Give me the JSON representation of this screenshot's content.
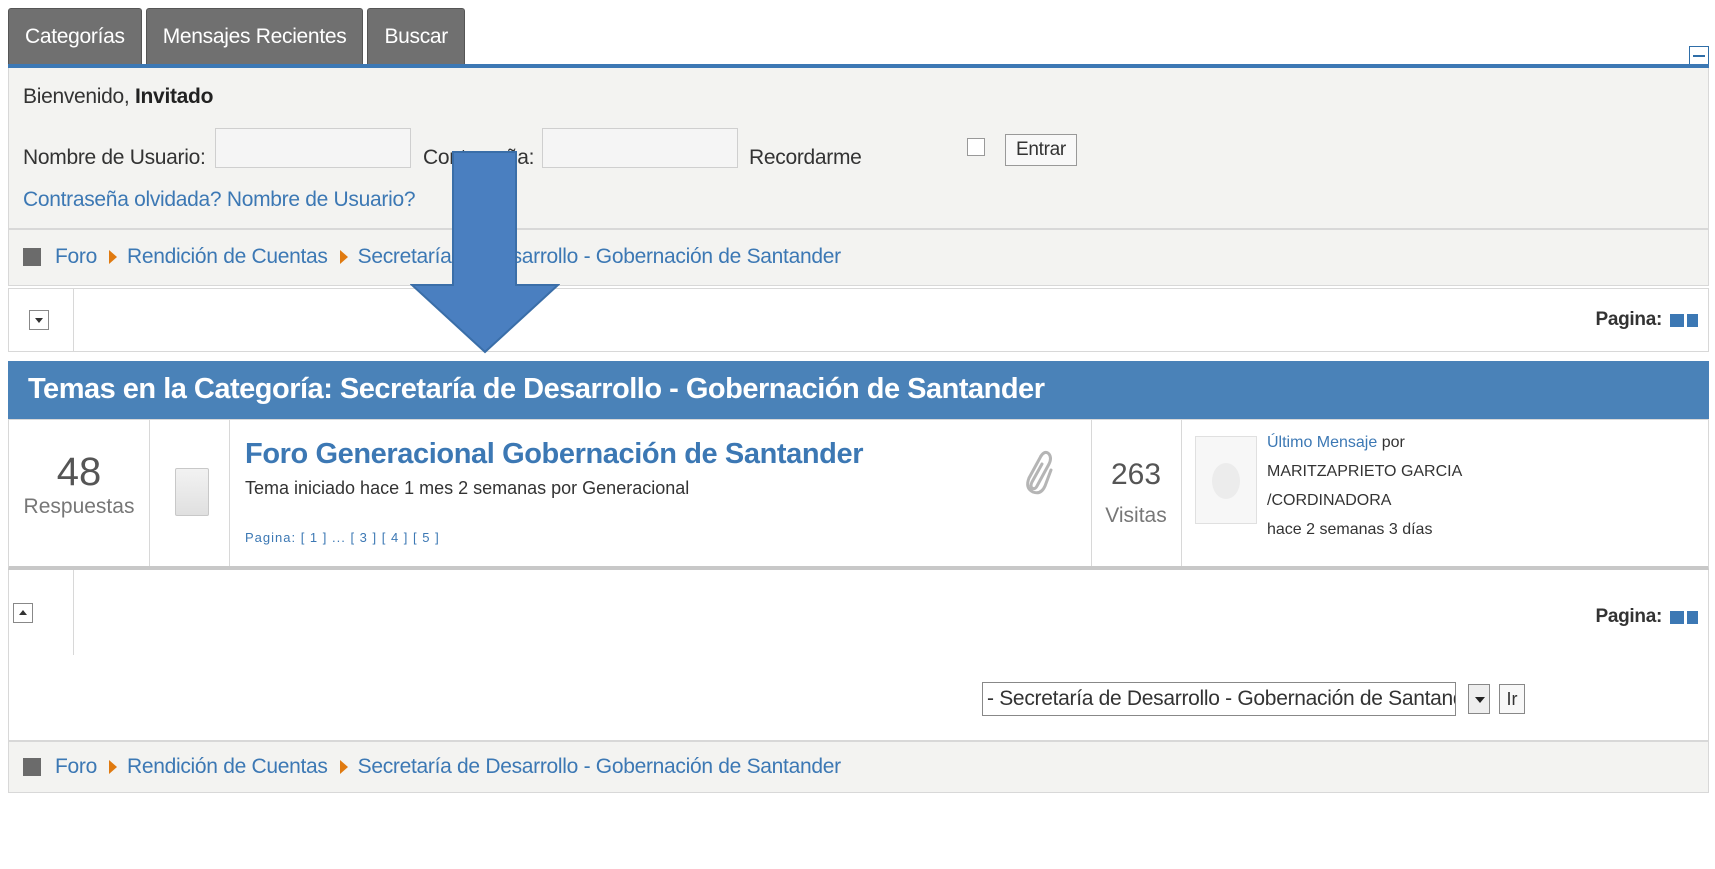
{
  "tabs": [
    "Categorías",
    "Mensajes Recientes",
    "Buscar"
  ],
  "login": {
    "welcome_prefix": "Bienvenido,",
    "welcome_user": "Invitado",
    "username_label": "Nombre de Usuario:",
    "password_label": "Contraseña:",
    "remember_label": "Recordarme",
    "submit_label": "Entrar",
    "forgot_link": "Contraseña olvidada? Nombre de Usuario?"
  },
  "breadcrumb": {
    "items": [
      "Foro",
      "Rendición de Cuentas",
      "Secretaría de Desarrollo - Gobernación de Santander"
    ]
  },
  "pager": {
    "label": "Pagina:"
  },
  "category": {
    "header": "Temas en la Categoría: Secretaría de Desarrollo - Gobernación de Santander"
  },
  "topic": {
    "replies": "48",
    "replies_label": "Respuestas",
    "title": "Foro Generacional Gobernación de Santander",
    "started": "Tema iniciado hace 1 mes 2 semanas por Generacional",
    "pages": "Pagina: [ 1 ] ... [ 3 ] [ 4 ] [ 5 ]",
    "views": "263",
    "views_label": "Visitas",
    "last_post_link": "Último Mensaje",
    "last_post_by": "por",
    "last_post_user_line1": "MARITZAPRIETO GARCIA",
    "last_post_user_line2": "/CORDINADORA",
    "last_post_time": "hace 2 semanas 3 días"
  },
  "jump": {
    "selected": "- Secretaría de Desarrollo - Gobernación de Santand",
    "go_label": "Ir"
  },
  "colors": {
    "accent": "#3c78b4",
    "header_bar": "#4a82b8",
    "tab_bg": "#707070",
    "crumb_arrow": "#e07a10",
    "overlay_arrow": "#4a7fc0"
  }
}
